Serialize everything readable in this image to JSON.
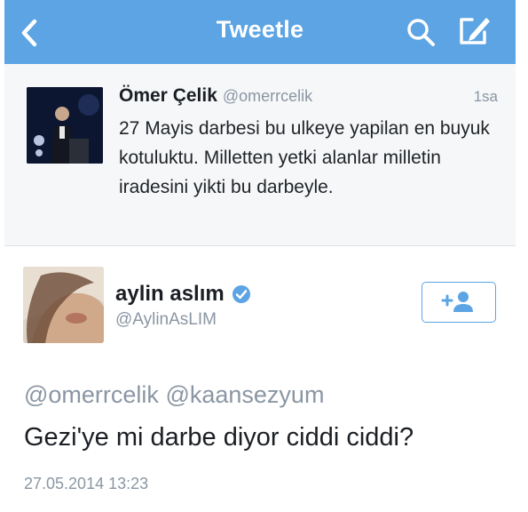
{
  "navbar": {
    "title": "Tweetle",
    "bg_color": "#5ca4e3",
    "icons": [
      "chevron-left-icon",
      "search-icon",
      "compose-icon"
    ]
  },
  "quoted_tweet": {
    "author_name": "Ömer Çelik",
    "author_handle": "@omerrcelik",
    "time": "1sa",
    "text": "27 Mayis darbesi bu ulkeye yapilan en buyuk kotuluktu. Milletten yetki alanlar milletin iradesini yikti bu darbeyle."
  },
  "reply_tweet": {
    "author_name": "aylin aslım",
    "author_handle": "@AylinAsLIM",
    "verified_icon": "verified-badge-icon",
    "follow_icon": "add-user-icon",
    "mentions": [
      "@omerrcelik",
      "@kaansezyum"
    ],
    "text": "Gezi'ye mi darbe diyor ciddi ciddi?",
    "timestamp": "27.05.2014 13:23"
  }
}
